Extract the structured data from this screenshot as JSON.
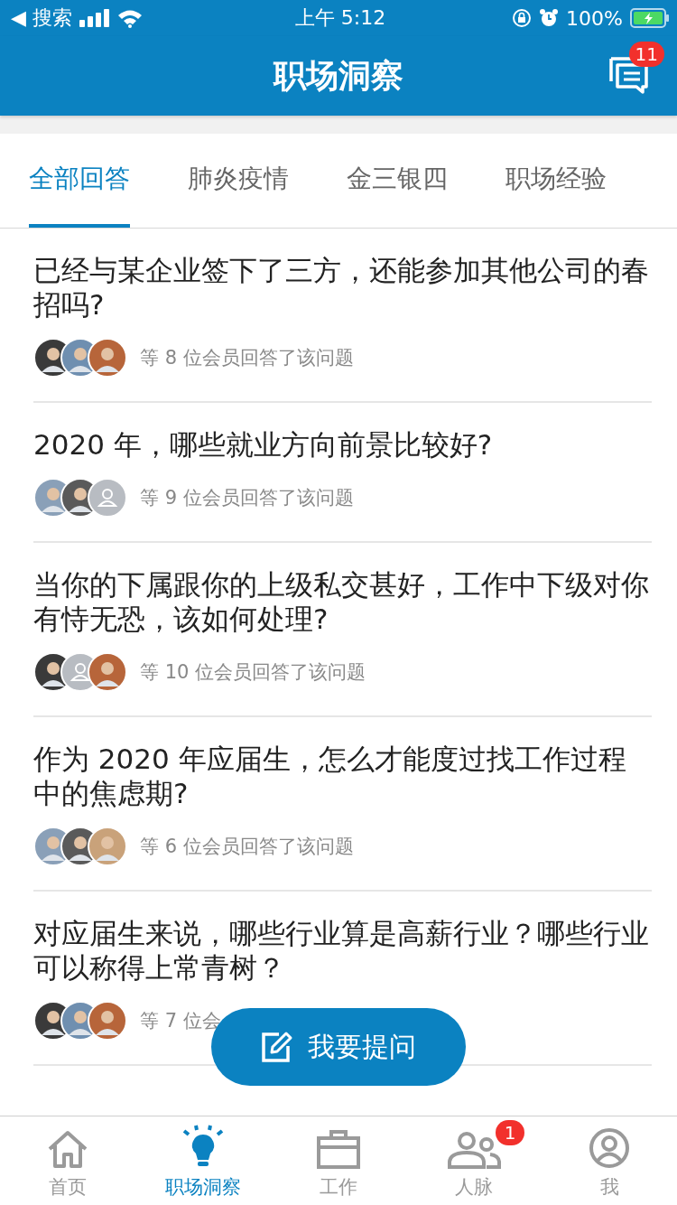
{
  "status_bar": {
    "back_label": "◀ 搜索",
    "time": "上午 5:12",
    "battery": "100%"
  },
  "header": {
    "title": "职场洞察",
    "message_badge": "11"
  },
  "tabs": [
    {
      "label": "全部回答",
      "selected": true
    },
    {
      "label": "肺炎疫情",
      "selected": false
    },
    {
      "label": "金三银四",
      "selected": false
    },
    {
      "label": "职场经验",
      "selected": false
    }
  ],
  "questions": [
    {
      "title": "已经与某企业签下了三方，还能参加其他公司的春招吗?",
      "answered": "等 8 位会员回答了该问题",
      "avatars": [
        {
          "kind": "photo"
        },
        {
          "kind": "photo"
        },
        {
          "kind": "photo"
        }
      ]
    },
    {
      "title": "2020 年，哪些就业方向前景比较好?",
      "answered": "等 9 位会员回答了该问题",
      "avatars": [
        {
          "kind": "photo"
        },
        {
          "kind": "photo"
        },
        {
          "kind": "placeholder"
        }
      ]
    },
    {
      "title": "当你的下属跟你的上级私交甚好，工作中下级对你有恃无恐，该如何处理?",
      "answered": "等 10 位会员回答了该问题",
      "avatars": [
        {
          "kind": "photo"
        },
        {
          "kind": "placeholder"
        },
        {
          "kind": "photo"
        }
      ]
    },
    {
      "title": "作为 2020 年应届生，怎么才能度过找工作过程中的焦虑期?",
      "answered": "等 6 位会员回答了该问题",
      "avatars": [
        {
          "kind": "photo"
        },
        {
          "kind": "photo"
        },
        {
          "kind": "photo"
        }
      ]
    },
    {
      "title": "对应届生来说，哪些行业算是高薪行业？哪些行业可以称得上常青树？",
      "answered": "等 7 位会",
      "avatars": [
        {
          "kind": "photo"
        },
        {
          "kind": "photo"
        },
        {
          "kind": "photo"
        }
      ]
    }
  ],
  "ask_button": {
    "label": "我要提问"
  },
  "nav": [
    {
      "label": "首页",
      "selected": false
    },
    {
      "label": "职场洞察",
      "selected": true
    },
    {
      "label": "工作",
      "selected": false
    },
    {
      "label": "人脉",
      "selected": false,
      "badge": "1"
    },
    {
      "label": "我",
      "selected": false
    }
  ]
}
